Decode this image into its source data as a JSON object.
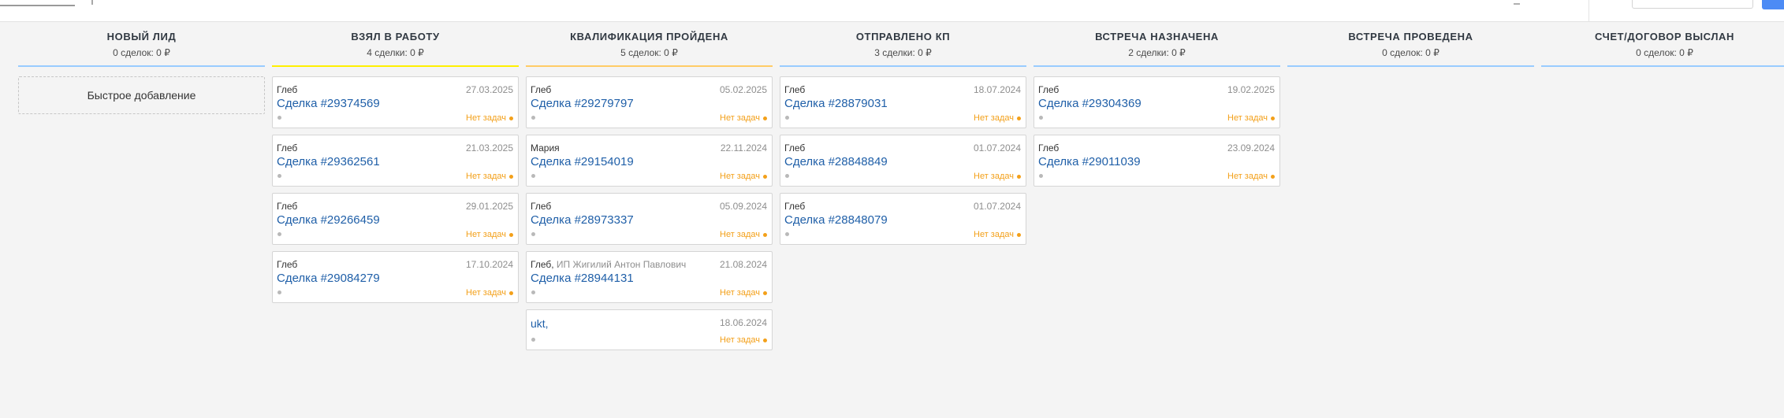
{
  "columns": [
    {
      "title": "НОВЫЙ ЛИД",
      "subtitle": "0 сделок: 0 ₽",
      "color": "#99ccff",
      "quick_add": "Быстрое добавление",
      "cards": []
    },
    {
      "title": "ВЗЯЛ В РАБОТУ",
      "subtitle": "4 сделки: 0 ₽",
      "color": "#fff000",
      "cards": [
        {
          "owner": "Глеб",
          "date": "27.03.2025",
          "deal": "Сделка #29374569",
          "tasks": "Нет задач"
        },
        {
          "owner": "Глеб",
          "date": "21.03.2025",
          "deal": "Сделка #29362561",
          "tasks": "Нет задач"
        },
        {
          "owner": "Глеб",
          "date": "29.01.2025",
          "deal": "Сделка #29266459",
          "tasks": "Нет задач"
        },
        {
          "owner": "Глеб",
          "date": "17.10.2024",
          "deal": "Сделка #29084279",
          "tasks": "Нет задач"
        }
      ]
    },
    {
      "title": "КВАЛИФИКАЦИЯ ПРОЙДЕНА",
      "subtitle": "5 сделок: 0 ₽",
      "color": "#ffcc66",
      "cards": [
        {
          "owner": "Глеб",
          "date": "05.02.2025",
          "deal": "Сделка #29279797",
          "tasks": "Нет задач"
        },
        {
          "owner": "Мария",
          "date": "22.11.2024",
          "deal": "Сделка #29154019",
          "tasks": "Нет задач"
        },
        {
          "owner": "Глеб",
          "date": "05.09.2024",
          "deal": "Сделка #28973337",
          "tasks": "Нет задач"
        },
        {
          "owner": "Глеб,",
          "owner_extra": " ИП Жигилий Антон Павлович",
          "date": "21.08.2024",
          "deal": "Сделка #28944131",
          "tasks": "Нет задач"
        },
        {
          "owner": "",
          "date": "18.06.2024",
          "deal": "ukt,",
          "tasks": "Нет задач",
          "short": true
        }
      ]
    },
    {
      "title": "ОТПРАВЛЕНО КП",
      "subtitle": "3 сделки: 0 ₽",
      "color": "#99ccff",
      "cards": [
        {
          "owner": "Глеб",
          "date": "18.07.2024",
          "deal": "Сделка #28879031",
          "tasks": "Нет задач"
        },
        {
          "owner": "Глеб",
          "date": "01.07.2024",
          "deal": "Сделка #28848849",
          "tasks": "Нет задач"
        },
        {
          "owner": "Глеб",
          "date": "01.07.2024",
          "deal": "Сделка #28848079",
          "tasks": "Нет задач"
        }
      ]
    },
    {
      "title": "ВСТРЕЧА НАЗНАЧЕНА",
      "subtitle": "2 сделки: 0 ₽",
      "color": "#99ccff",
      "cards": [
        {
          "owner": "Глеб",
          "date": "19.02.2025",
          "deal": "Сделка #29304369",
          "tasks": "Нет задач"
        },
        {
          "owner": "Глеб",
          "date": "23.09.2024",
          "deal": "Сделка #29011039",
          "tasks": "Нет задач"
        }
      ]
    },
    {
      "title": "ВСТРЕЧА ПРОВЕДЕНА",
      "subtitle": "0 сделок: 0 ₽",
      "color": "#99ccff",
      "cards": []
    },
    {
      "title": "СЧЕТ/ДОГОВОР ВЫСЛАН",
      "subtitle": "0 сделок: 0 ₽",
      "color": "#99ccff",
      "cards": []
    }
  ]
}
